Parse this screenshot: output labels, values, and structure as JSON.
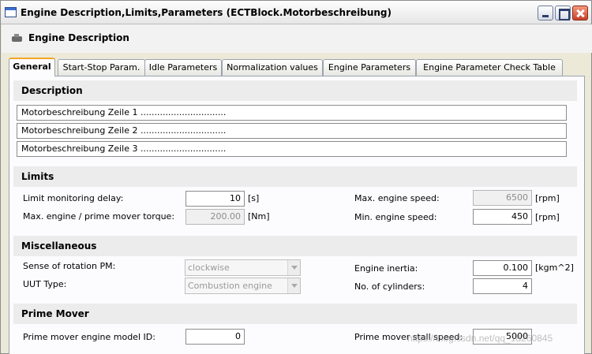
{
  "window": {
    "title": "Engine Description,Limits,Parameters (ECTBlock.Motorbeschreibung)",
    "subtitle": "Engine Description"
  },
  "tabs": [
    {
      "label": "General",
      "active": true
    },
    {
      "label": "Start-Stop Param."
    },
    {
      "label": "Idle Parameters"
    },
    {
      "label": "Normalization values"
    },
    {
      "label": "Engine Parameters"
    },
    {
      "label": "Engine Parameter Check Table"
    }
  ],
  "description": {
    "heading": "Description",
    "lines": [
      "Motorbeschreibung Zeile 1 ...............................",
      "Motorbeschreibung Zeile 2 ...............................",
      "Motorbeschreibung Zeile 3 ..............................."
    ]
  },
  "limits": {
    "heading": "Limits",
    "monitoring_delay": {
      "label": "Limit monitoring delay:",
      "value": "10",
      "unit": "[s]"
    },
    "max_torque": {
      "label": "Max. engine / prime mover torque:",
      "value": "200.00",
      "unit": "[Nm]"
    },
    "max_speed": {
      "label": "Max. engine speed:",
      "value": "6500",
      "unit": "[rpm]"
    },
    "min_speed": {
      "label": "Min. engine speed:",
      "value": "450",
      "unit": "[rpm]"
    }
  },
  "misc": {
    "heading": "Miscellaneous",
    "rotation": {
      "label": "Sense of rotation PM:",
      "value": "clockwise"
    },
    "uut_type": {
      "label": "UUT Type:",
      "value": "Combustion engine"
    },
    "inertia": {
      "label": "Engine inertia:",
      "value": "0.100",
      "unit": "[kgm^2]"
    },
    "cylinders": {
      "label": "No. of cylinders:",
      "value": "4"
    }
  },
  "prime_mover": {
    "heading": "Prime Mover",
    "model_id": {
      "label": "Prime mover engine model ID:",
      "value": "0"
    },
    "stall_speed": {
      "label": "Prime mover stall speed:",
      "value": "5000"
    }
  },
  "watermark": "https://blog.csdn.net/qq_18260845"
}
